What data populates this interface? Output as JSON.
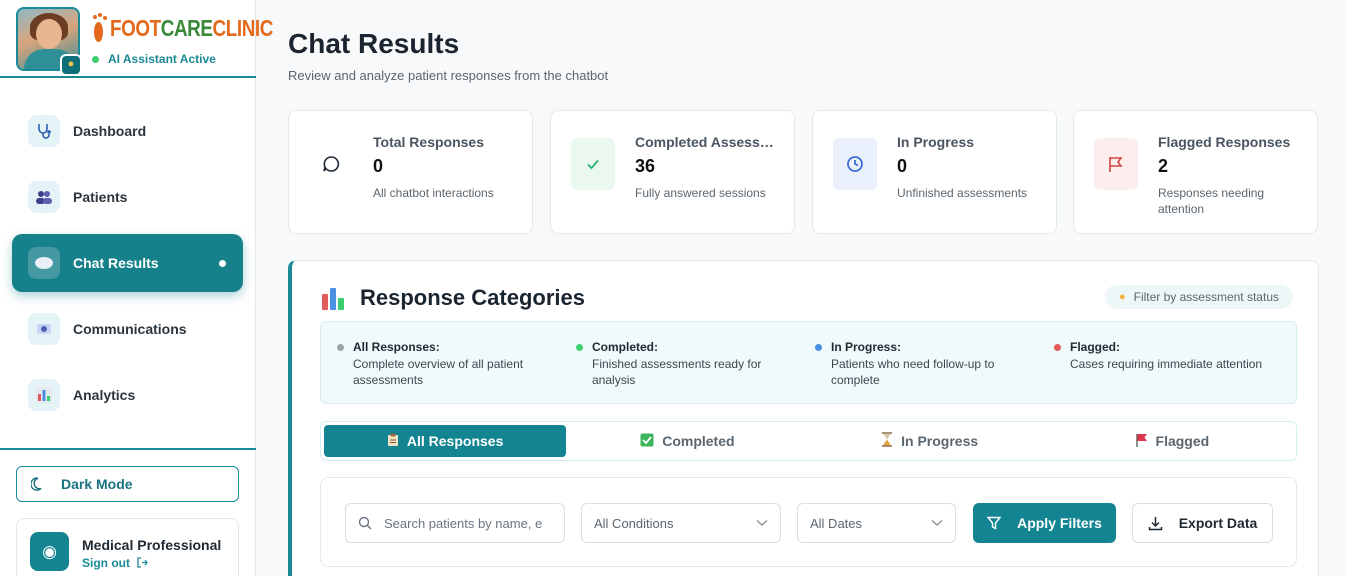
{
  "brand": {
    "logo_part1": "FOOT",
    "logo_part2": "CARE",
    "logo_part3": "CLINIC",
    "status": "AI Assistant Active"
  },
  "sidebar": {
    "items": [
      {
        "label": "Dashboard",
        "icon": "stethoscope-icon"
      },
      {
        "label": "Patients",
        "icon": "users-icon"
      },
      {
        "label": "Chat Results",
        "icon": "speech-bubble-icon",
        "active": true
      },
      {
        "label": "Communications",
        "icon": "mailbox-icon"
      },
      {
        "label": "Analytics",
        "icon": "bar-chart-icon"
      }
    ],
    "dark_mode_label": "Dark Mode",
    "user": {
      "name": "Medical Professional",
      "signout": "Sign out"
    }
  },
  "header": {
    "title": "Chat Results",
    "subtitle": "Review and analyze patient responses from the chatbot"
  },
  "stats": [
    {
      "label": "Total Responses",
      "value": "0",
      "desc": "All chatbot interactions",
      "icon": "chat-icon",
      "color": "#ffffff"
    },
    {
      "label": "Completed Assessments",
      "value": "36",
      "desc": "Fully answered sessions",
      "icon": "check-icon",
      "color": "#eaf8ef"
    },
    {
      "label": "In Progress",
      "value": "0",
      "desc": "Unfinished assessments",
      "icon": "clock-icon",
      "color": "#eaf1fc"
    },
    {
      "label": "Flagged Responses",
      "value": "2",
      "desc": "Responses needing attention",
      "icon": "flag-icon",
      "color": "#fdeeee"
    }
  ],
  "categories": {
    "title": "Response Categories",
    "hint": "Filter by assessment status",
    "legend": [
      {
        "title": "All Responses:",
        "desc": "Complete overview of all patient assessments",
        "color": "#9aa3a9"
      },
      {
        "title": "Completed:",
        "desc": "Finished assessments ready for analysis",
        "color": "#3ccf6e"
      },
      {
        "title": "In Progress:",
        "desc": "Patients who need follow-up to complete",
        "color": "#4a90e2"
      },
      {
        "title": "Flagged:",
        "desc": "Cases requiring immediate attention",
        "color": "#e15b5b"
      }
    ],
    "tabs": [
      {
        "label": "All Responses",
        "icon": "clipboard-icon",
        "active": true
      },
      {
        "label": "Completed",
        "icon": "check-box-icon"
      },
      {
        "label": "In Progress",
        "icon": "hourglass-icon"
      },
      {
        "label": "Flagged",
        "icon": "flag-icon"
      }
    ]
  },
  "filters": {
    "search_placeholder": "Search patients by name, e",
    "conditions": "All Conditions",
    "dates": "All Dates",
    "apply": "Apply Filters",
    "export": "Export Data"
  }
}
